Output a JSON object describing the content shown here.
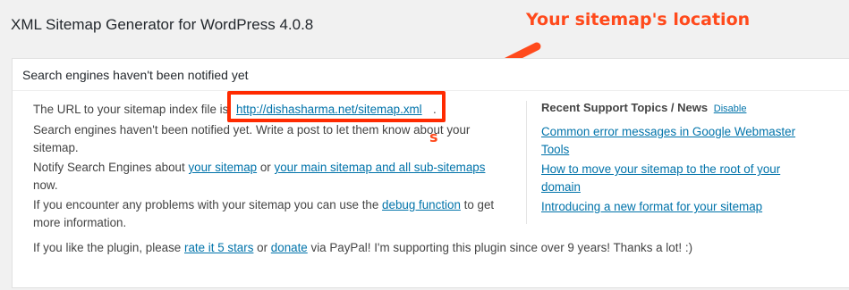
{
  "page": {
    "title": "XML Sitemap Generator for WordPress 4.0.8"
  },
  "annotation": {
    "title": "Your sitemap's location",
    "letter": "s",
    "color": "#ff4a1c"
  },
  "panel": {
    "heading": "Search engines haven't been notified yet",
    "url_prefix": "The URL to your sitemap index file is:",
    "url_link": "http://dishasharma.net/sitemap.xml",
    "url_suffix": ".",
    "not_notified": "Search engines haven't been notified yet. Write a post to let them know about your",
    "not_notified_2": "sitemap.",
    "notify_prefix": "Notify Search Engines about",
    "notify_link1": "your sitemap",
    "notify_mid": "or",
    "notify_link2": "your main sitemap and all sub-sitemaps",
    "notify_now": "now.",
    "problems_prefix": "If you encounter any problems with your sitemap you can use the",
    "problems_link": "debug function",
    "problems_suffix": "to get",
    "problems_line2": "more information.",
    "like_prefix": "If you like the plugin, please",
    "like_link1": "rate it 5 stars",
    "like_mid": "or",
    "like_link2": "donate",
    "like_suffix": "via PayPal! I'm supporting this plugin since over 9 years! Thanks a lot! :)"
  },
  "sidebar": {
    "title": "Recent Support Topics / News",
    "disable_label": "Disable",
    "links": [
      {
        "line1": "Common error messages in Google Webmaster",
        "line2": "Tools"
      },
      {
        "line1": "How to move your sitemap to the root of your",
        "line2": "domain"
      },
      {
        "line1": "Introducing a new format for your sitemap",
        "line2": ""
      }
    ]
  },
  "colors": {
    "accent": "#ff2a00",
    "link": "#0073aa"
  }
}
